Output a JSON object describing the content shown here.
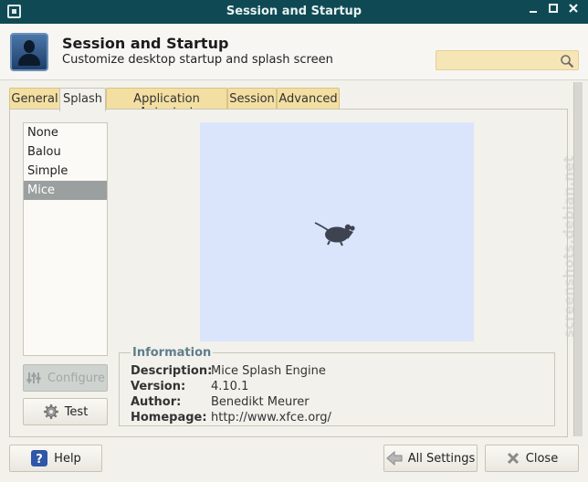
{
  "window": {
    "title": "Session and Startup"
  },
  "header": {
    "title": "Session and Startup",
    "subtitle": "Customize desktop startup and splash screen",
    "search": {
      "value": "",
      "placeholder": ""
    }
  },
  "tabs": [
    {
      "label": "General",
      "active": false
    },
    {
      "label": "Splash",
      "active": true
    },
    {
      "label": "Application Autostart",
      "active": false
    },
    {
      "label": "Session",
      "active": false
    },
    {
      "label": "Advanced",
      "active": false
    }
  ],
  "splash": {
    "engines": [
      "None",
      "Balou",
      "Simple",
      "Mice"
    ],
    "selected": "Mice",
    "configure_label": "Configure",
    "test_label": "Test"
  },
  "info": {
    "legend": "Information",
    "rows": [
      {
        "key": "Description:",
        "value": "Mice Splash Engine"
      },
      {
        "key": "Version:",
        "value": "4.10.1"
      },
      {
        "key": "Author:",
        "value": "Benedikt Meurer"
      },
      {
        "key": "Homepage:",
        "value": "http://www.xfce.org/"
      }
    ]
  },
  "footer": {
    "help_label": "Help",
    "all_settings_label": "All Settings",
    "close_label": "Close"
  },
  "watermark": "screenshots.debian.net",
  "colors": {
    "titlebar": "#0f4a54",
    "tab": "#f3dfa2",
    "preview": "#dae5fb",
    "selection": "#9aa09f"
  }
}
